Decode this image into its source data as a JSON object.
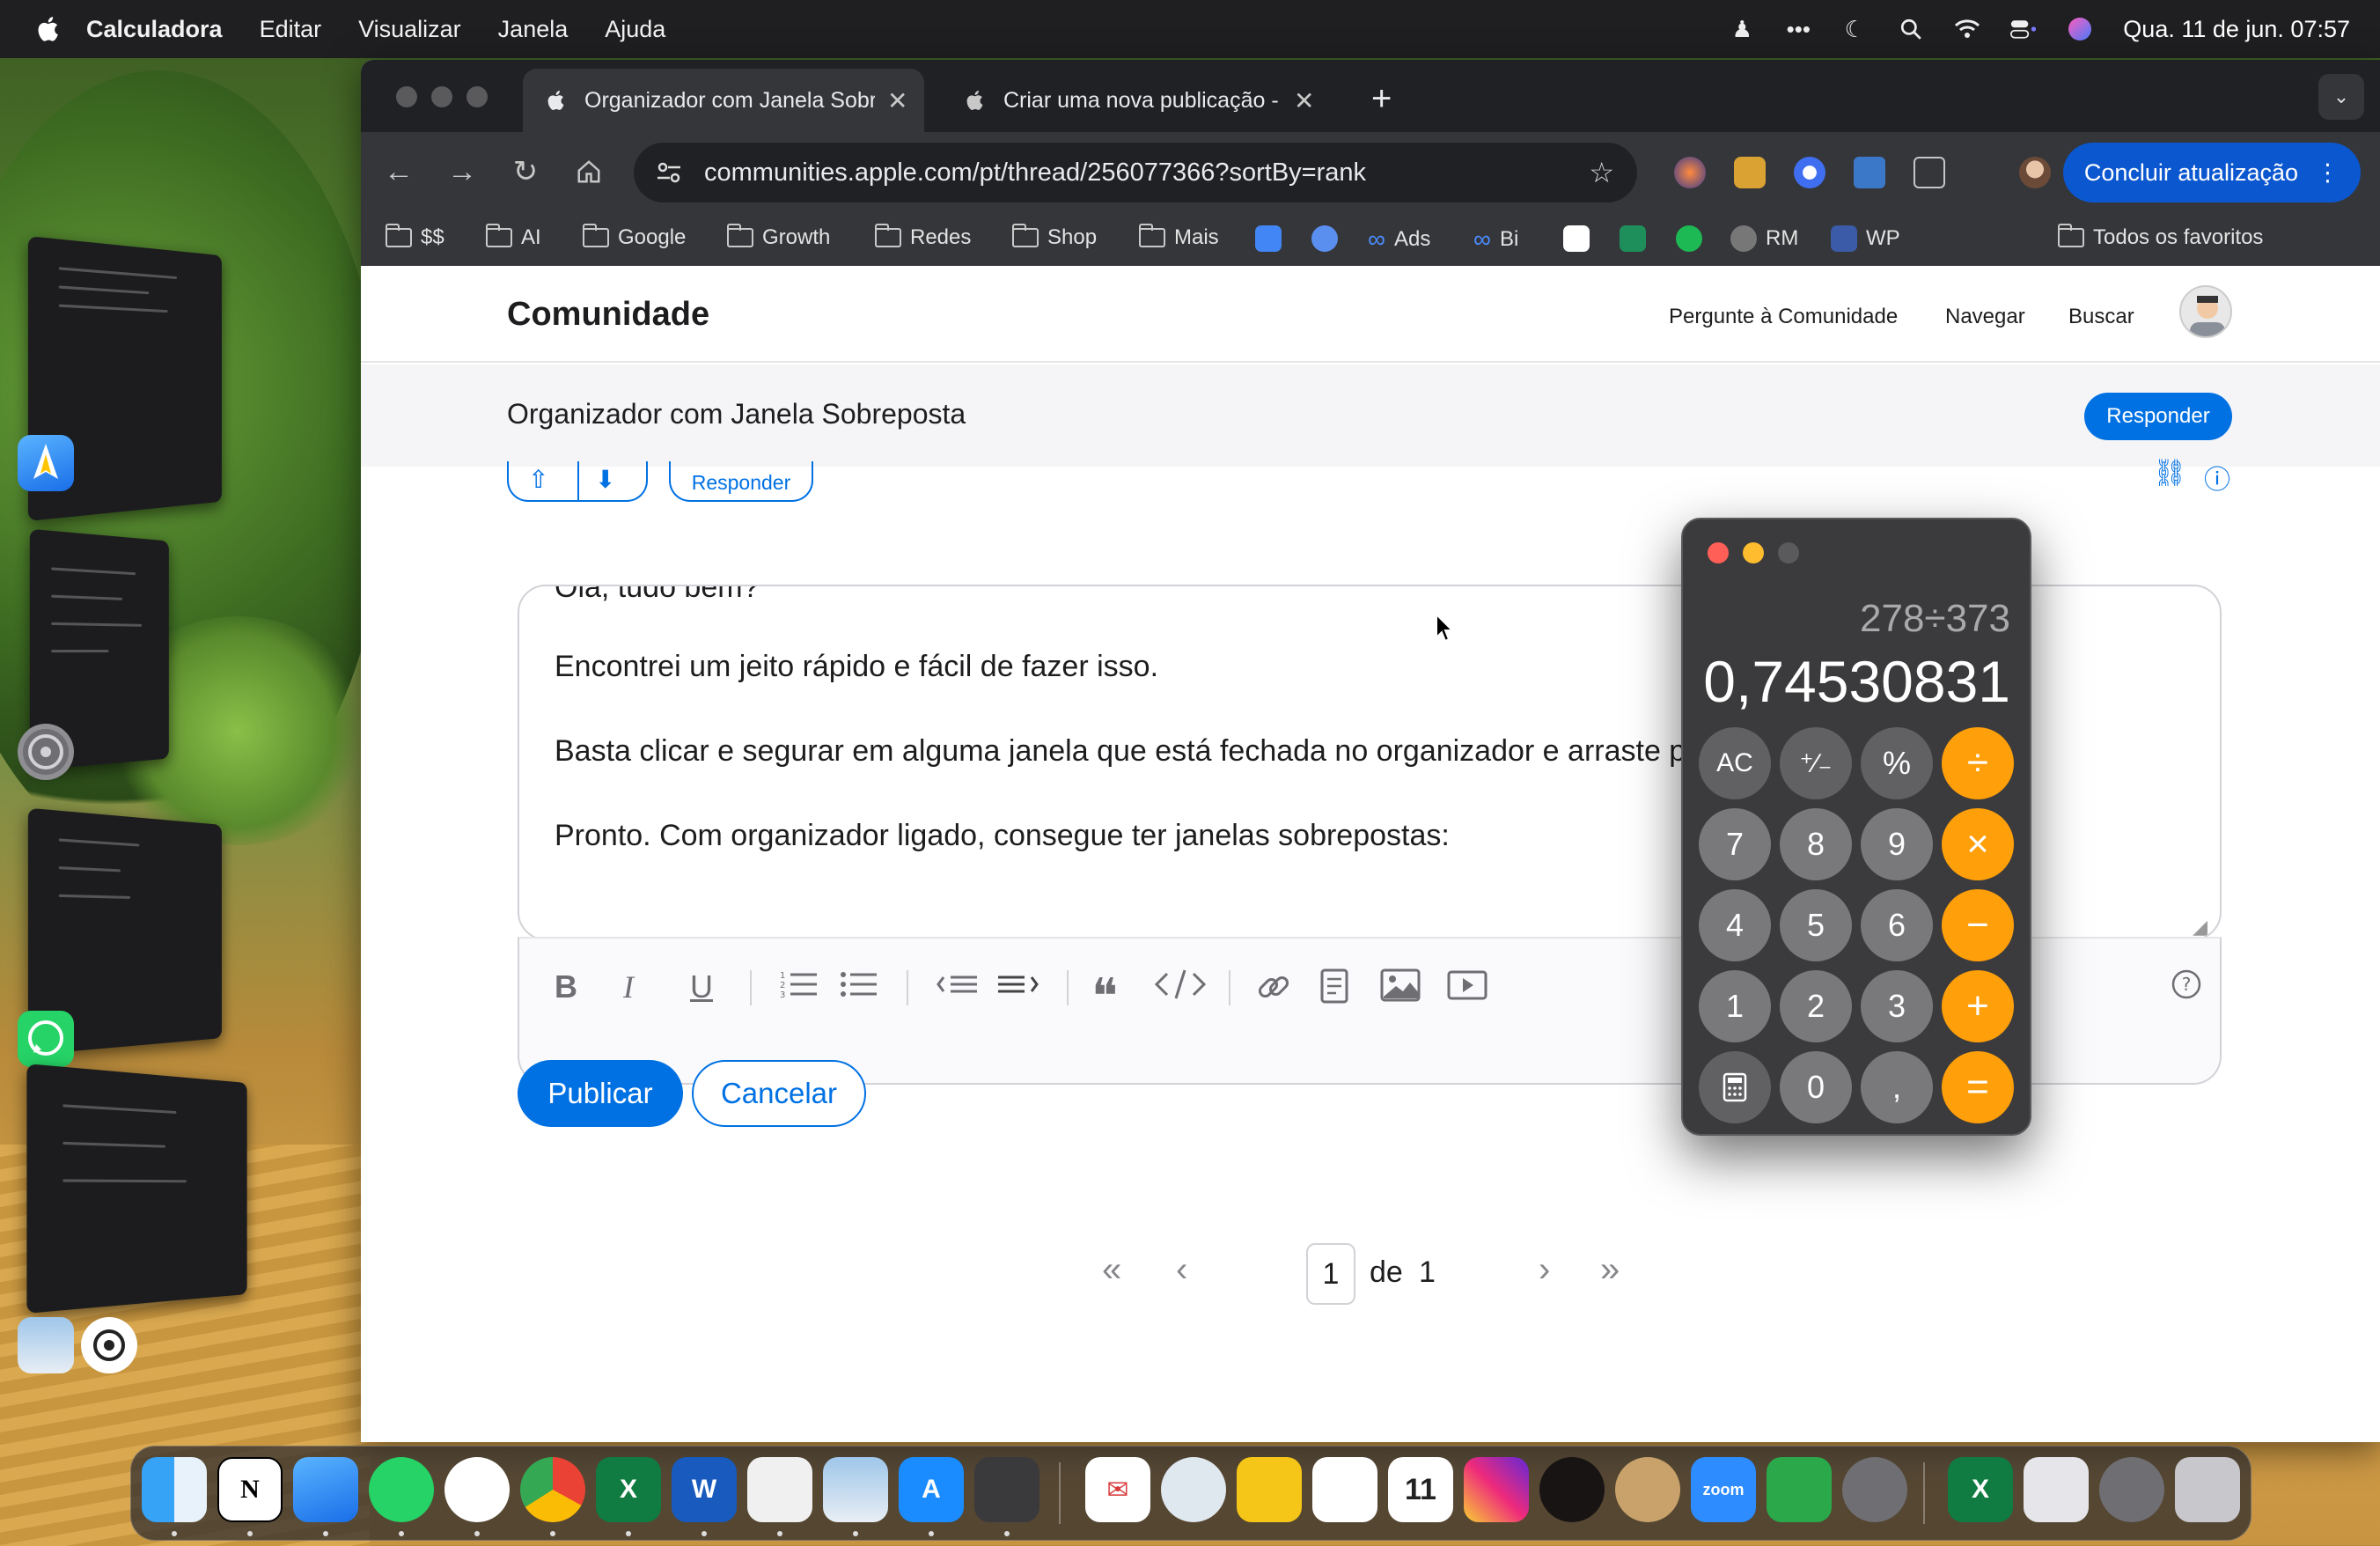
{
  "menubar": {
    "app_name": "Calculadora",
    "items": [
      "Editar",
      "Visualizar",
      "Janela",
      "Ajuda"
    ],
    "clock": "Qua. 11 de jun. 07:57"
  },
  "browser": {
    "tabs": [
      {
        "title": "Organizador com Janela Sobreposta",
        "active": true
      },
      {
        "title": "Criar uma nova publicação - Comunidade",
        "active": false
      }
    ],
    "url": "communities.apple.com/pt/thread/256077366?sortBy=rank",
    "update_button": "Concluir atualização",
    "bookmarks": [
      {
        "label": "$$",
        "type": "folder"
      },
      {
        "label": "AI",
        "type": "folder"
      },
      {
        "label": "Google",
        "type": "folder"
      },
      {
        "label": "Growth",
        "type": "folder"
      },
      {
        "label": "Redes",
        "type": "folder"
      },
      {
        "label": "Shop",
        "type": "folder"
      },
      {
        "label": "Mais",
        "type": "folder"
      },
      {
        "label": "Ads",
        "type": "meta"
      },
      {
        "label": "Bi",
        "type": "meta"
      },
      {
        "label": "RM",
        "type": "site"
      },
      {
        "label": "WP",
        "type": "site"
      }
    ],
    "all_bookmarks": "Todos os favoritos"
  },
  "page": {
    "brand": "Comunidade",
    "nav": [
      "Pergunte à Comunidade",
      "Navegar",
      "Buscar"
    ],
    "thread_title": "Organizador com Janela Sobreposta",
    "reply_button": "Responder",
    "reply_small": "Responder",
    "editor_lines": [
      "Olá, tudo bem?",
      "Encontrei um jeito rápido e fácil de fazer isso.",
      "Basta clicar e segurar em alguma janela que está fechada no organizador e arraste para cima da outra janela.",
      "Pronto. Com organizador ligado, consegue ter janelas sobrepostas:"
    ],
    "publish": "Publicar",
    "cancel": "Cancelar",
    "pager": {
      "current": "1",
      "of_label": "de",
      "total": "1"
    }
  },
  "calculator": {
    "expression": "278÷373",
    "display": "0,74530831",
    "keys": [
      [
        "AC",
        "⁺∕₋",
        "%",
        "÷"
      ],
      [
        "7",
        "8",
        "9",
        "×"
      ],
      [
        "4",
        "5",
        "6",
        "−"
      ],
      [
        "1",
        "2",
        "3",
        "+"
      ],
      [
        "calc-icon",
        "0",
        ",",
        "="
      ]
    ]
  },
  "colors": {
    "accent": "#0071e3",
    "calc_operator": "#ff9f0a",
    "chrome_update": "#0b57d0"
  }
}
